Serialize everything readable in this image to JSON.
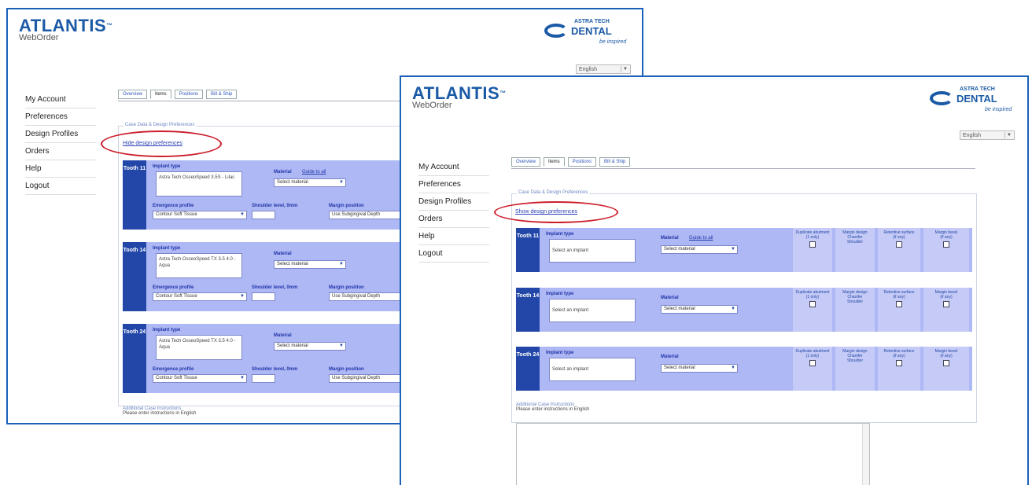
{
  "app": {
    "brand": "ATLANTIS",
    "brand_mark": "™",
    "subtitle": "WebOrder",
    "partner_top": "ASTRA TECH",
    "partner_main": "DENTAL",
    "partner_tag": "be inspired",
    "language": "English"
  },
  "sidebar": {
    "items": [
      "My Account",
      "Preferences",
      "Design Profiles",
      "Orders",
      "Help",
      "Logout"
    ]
  },
  "tabs": [
    "Overview",
    "Items",
    "Positions",
    "Bill & Ship"
  ],
  "window_back": {
    "section_legend": "Case Data & Design Preferences",
    "toggle_link": "Hide design preferences",
    "teeth": [
      {
        "label": "Tooth 11",
        "implant_type": "Astra Tech OsseoSpeed 3.5S - Lilac",
        "material": "Select material",
        "emergence": "Contour Soft Tissue",
        "margin_position": "Use Subgingival Depth"
      },
      {
        "label": "Tooth 14",
        "implant_type": "Astra Tech OsseoSpeed TX 3.5 4.0 - Aqua",
        "material": "Select material",
        "emergence": "Contour Soft Tissue",
        "margin_position": "Use Subgingival Depth"
      },
      {
        "label": "Tooth 24",
        "implant_type": "Astra Tech OsseoSpeed TX 3.5 4.0 - Aqua",
        "material": "Select material",
        "emergence": "Contour Soft Tissue",
        "margin_position": "Use Subgingival Depth"
      }
    ],
    "labels": {
      "implant_type": "Implant type",
      "material": "Material",
      "material_help": "Guide to all",
      "emergence": "Emergence profile",
      "shoulder": "Shoulder level, 0mm",
      "margin_position": "Margin position"
    },
    "notes_heading": "Additional Case Instructions",
    "notes_text": "Please enter instructions in English"
  },
  "window_front": {
    "section_legend": "Case Data & Design Preferences",
    "toggle_link": "Show design preferences",
    "teeth": [
      {
        "label": "Tooth 11",
        "implant_prompt": "Select an implant",
        "material": "Select material"
      },
      {
        "label": "Tooth 14",
        "implant_prompt": "Select an implant",
        "material": "Select material"
      },
      {
        "label": "Tooth 24",
        "implant_prompt": "Select an implant",
        "material": "Select material"
      }
    ],
    "labels": {
      "implant_type": "Implant type",
      "material": "Material",
      "material_help": "Guide to all"
    },
    "columns": [
      {
        "title": "Duplicate abutment",
        "sub": "(1 only)"
      },
      {
        "title": "Margin design",
        "opt1": "Chamfer",
        "opt2": "Shoulder"
      },
      {
        "title": "Retentive surface",
        "sub": "(if any)"
      },
      {
        "title": "Margin bevel",
        "sub": "(if any)"
      }
    ],
    "notes_heading": "Additional Case Instructions",
    "notes_text": "Please enter instructions in English"
  },
  "colors": {
    "window_border": "#1a61b7",
    "tooth_panel": "#aeb8f4",
    "tooth_tag": "#2347a8",
    "annotation": "#cc1f2b"
  }
}
